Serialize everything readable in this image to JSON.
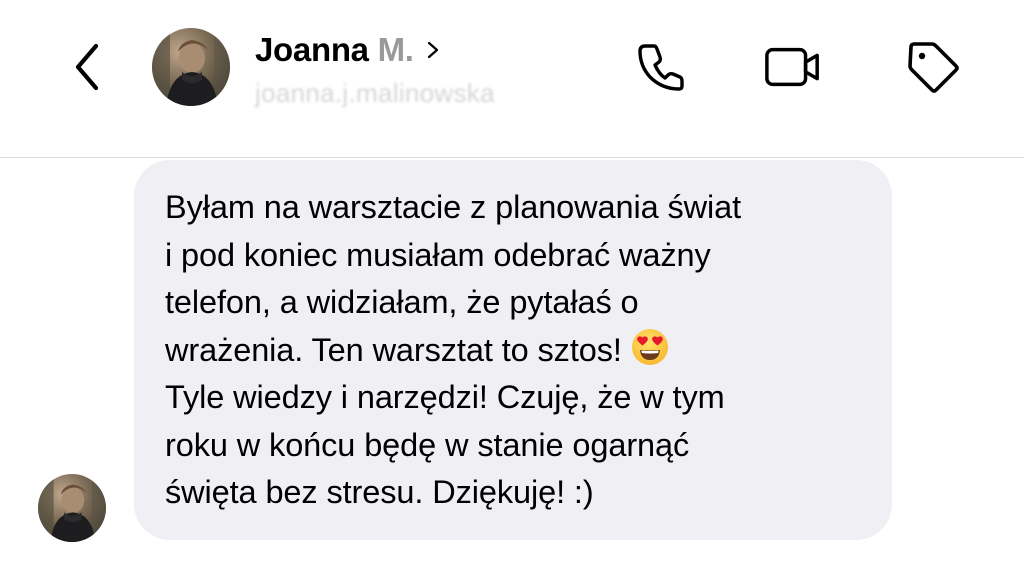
{
  "header": {
    "back_icon": "chevron-left-icon",
    "contact_name_main": "Joanna ",
    "contact_name_faded": "M.",
    "contact_chevron_icon": "chevron-right-icon",
    "contact_username": "joanna.j.malinowska",
    "actions": {
      "phone_icon": "phone-icon",
      "video_icon": "video-camera-icon",
      "tag_icon": "tag-icon"
    }
  },
  "thread": {
    "message": {
      "text": "Byłam na warsztacie z planowania świat\ni pod koniec musiałam odebrać ważny\ntelefon, a widziałam, że pytałaś o\nwrażenia. Ten warsztat to sztos!",
      "emoji": "heart-eyes-emoji",
      "text_after": "Tyle wiedzy i narzędzi! Czuję, że w tym\nroku w końcu będę w stanie ogarnąć\nświęta bez stresu. Dziękuję! :)",
      "bubble_color": "#efeff4"
    }
  },
  "colors": {
    "background": "#ffffff",
    "divider": "#dbdbdb",
    "text": "#000000",
    "username": "#d6d6d6"
  }
}
